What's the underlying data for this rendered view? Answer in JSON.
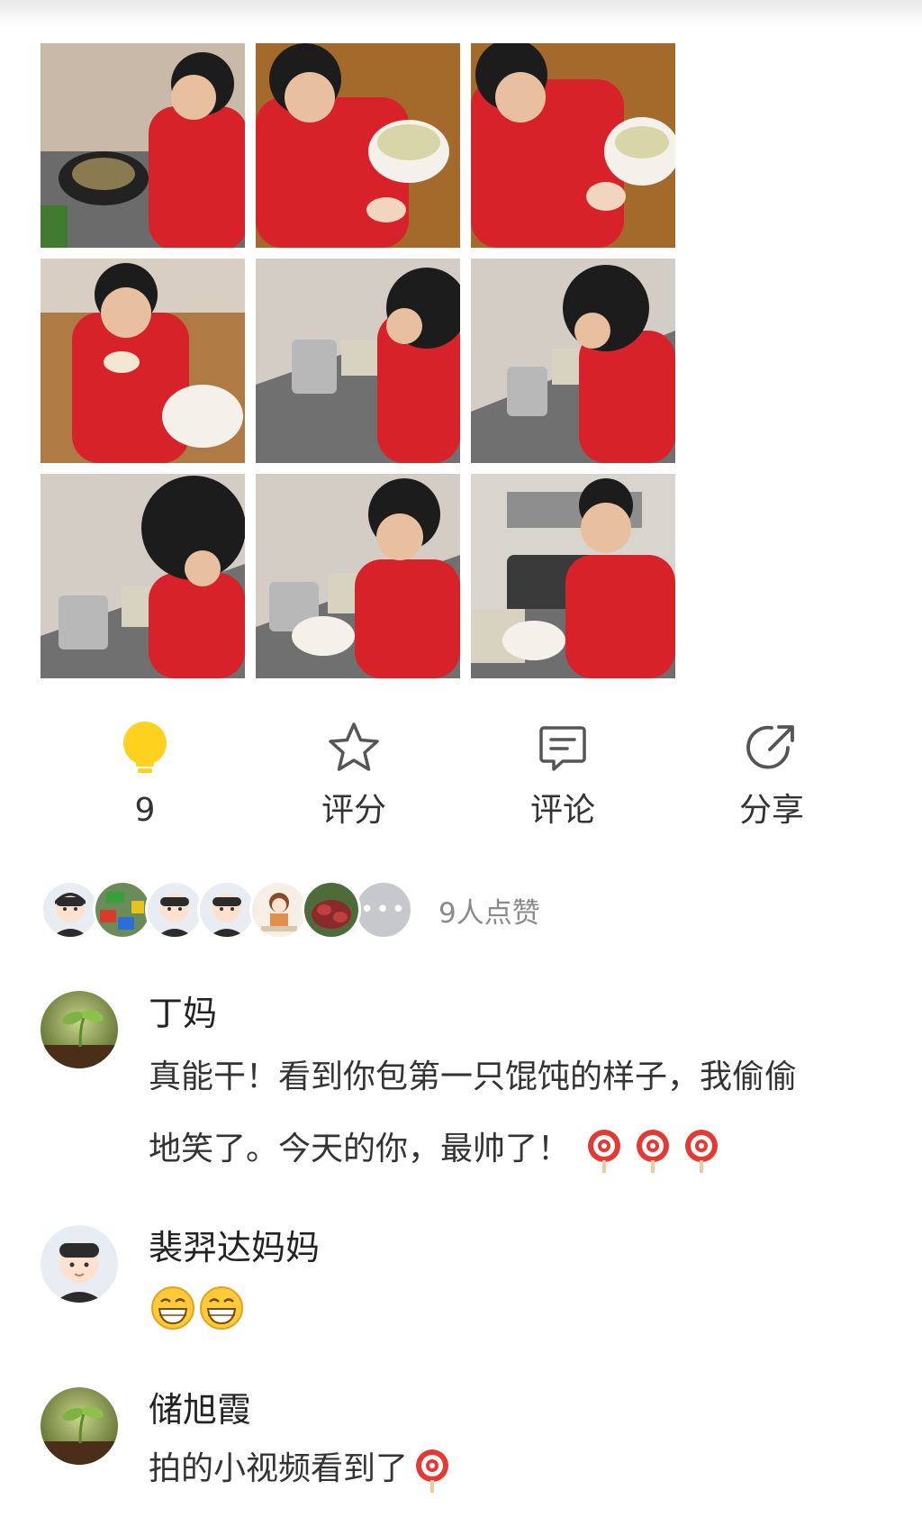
{
  "post": {
    "photos": [
      {
        "alt": "photo-1"
      },
      {
        "alt": "photo-2"
      },
      {
        "alt": "photo-3"
      },
      {
        "alt": "photo-4"
      },
      {
        "alt": "photo-5"
      },
      {
        "alt": "photo-6"
      },
      {
        "alt": "photo-7"
      },
      {
        "alt": "photo-8"
      },
      {
        "alt": "photo-9"
      }
    ]
  },
  "actions": {
    "like_count": "9",
    "rate_label": "评分",
    "comment_label": "评论",
    "share_label": "分享",
    "like_icon_color": "#FFD21F",
    "icon_color": "#555555"
  },
  "likes": {
    "more_label": "•••",
    "summary": "9人点赞"
  },
  "comments": [
    {
      "name": "丁妈",
      "text_line1": "真能干！看到你包第一只馄饨的样子，我偷偷",
      "text_line2": "地笑了。今天的你，最帅了！",
      "emoji": "lollipop-icon",
      "avatar": "sprout"
    },
    {
      "name": "裴羿达妈妈",
      "text": "",
      "emoji": "grin-icon",
      "avatar": "boy"
    },
    {
      "name": "储旭霞",
      "text": "拍的小视频看到了",
      "emoji": "lollipop-icon",
      "avatar": "sprout"
    }
  ]
}
